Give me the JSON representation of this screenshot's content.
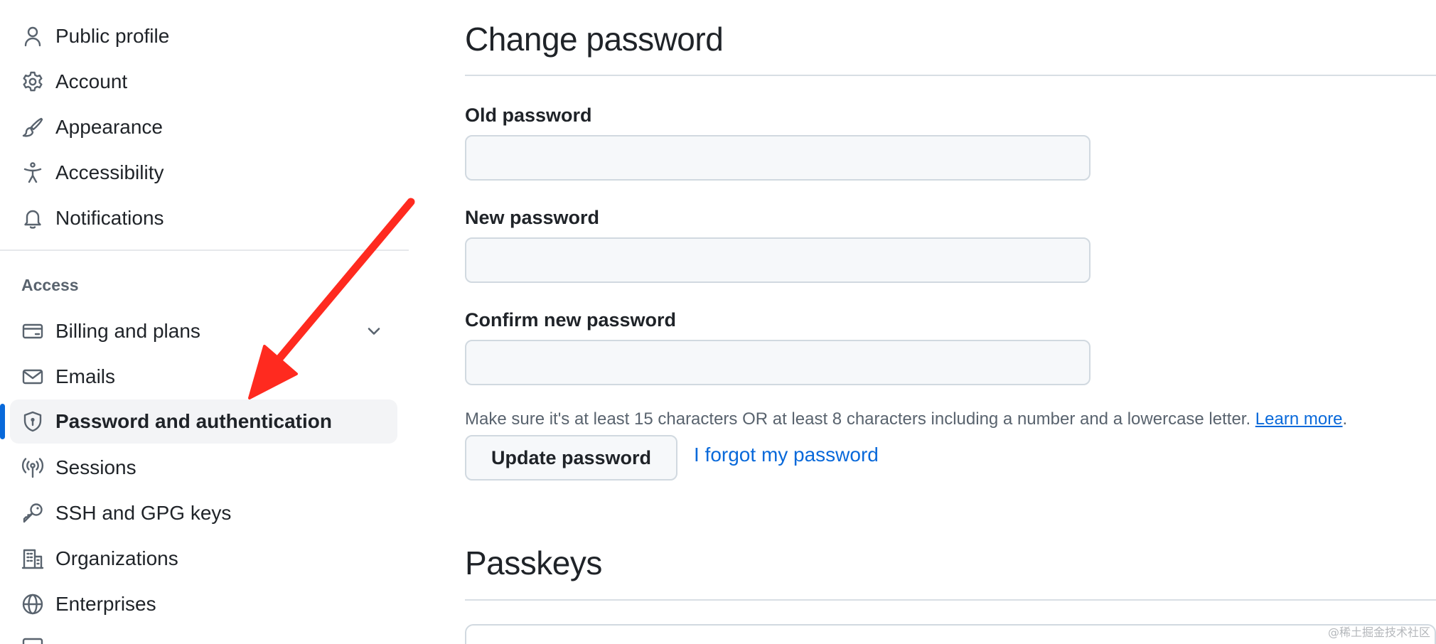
{
  "sidebar": {
    "items_top": [
      {
        "label": "Public profile",
        "icon": "person-icon"
      },
      {
        "label": "Account",
        "icon": "gear-icon"
      },
      {
        "label": "Appearance",
        "icon": "paintbrush-icon"
      },
      {
        "label": "Accessibility",
        "icon": "accessibility-icon"
      },
      {
        "label": "Notifications",
        "icon": "bell-icon"
      }
    ],
    "section_heading": "Access",
    "items_access": [
      {
        "label": "Billing and plans",
        "icon": "credit-card-icon"
      },
      {
        "label": "Emails",
        "icon": "mail-icon"
      },
      {
        "label": "Password and authentication",
        "icon": "shield-lock-icon",
        "active": true
      },
      {
        "label": "Sessions",
        "icon": "broadcast-icon"
      },
      {
        "label": "SSH and GPG keys",
        "icon": "key-icon"
      },
      {
        "label": "Organizations",
        "icon": "organization-icon"
      },
      {
        "label": "Enterprises",
        "icon": "globe-icon"
      }
    ]
  },
  "main": {
    "change_password": {
      "title": "Change password",
      "old_label": "Old password",
      "old_value": "",
      "new_label": "New password",
      "new_value": "",
      "confirm_label": "Confirm new password",
      "confirm_value": "",
      "note": "Make sure it's at least 15 characters OR at least 8 characters including a number and a lowercase letter.",
      "learn_more": "Learn more",
      "period": ".",
      "update_button": "Update password",
      "forgot_link": "I forgot my password"
    },
    "passkeys": {
      "title": "Passkeys"
    }
  },
  "colors": {
    "accent": "#0969da",
    "annotation_arrow": "#ff2a1f",
    "active_bg": "#f3f4f6"
  },
  "watermark": "@稀土掘金技术社区"
}
